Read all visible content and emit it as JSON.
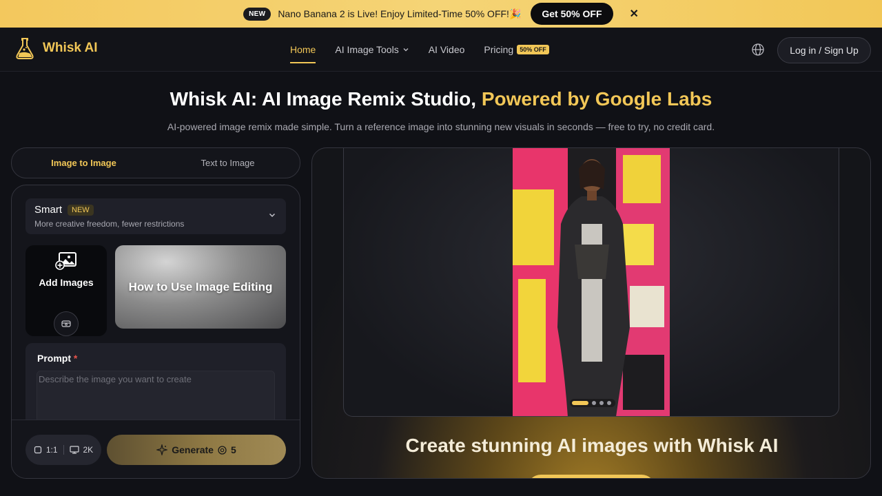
{
  "promo": {
    "badge": "NEW",
    "text": "Nano Banana 2 is Live! Enjoy Limited-Time 50% OFF!🎉",
    "cta": "Get 50% OFF",
    "close": "✕"
  },
  "nav": {
    "brand": "Whisk AI",
    "items": [
      {
        "label": "Home",
        "active": true
      },
      {
        "label": "AI Image Tools",
        "dropdown": true
      },
      {
        "label": "AI Video"
      },
      {
        "label": "Pricing",
        "badge": "50% OFF"
      }
    ],
    "language_icon": "globe-icon",
    "login": "Log in / Sign Up"
  },
  "hero": {
    "title": "Whisk AI: AI Image Remix Studio, ",
    "title_highlight": "Powered by Google Labs",
    "subtitle": "AI-powered image remix made simple. Turn a reference image into stunning new visuals in seconds — free to try, no credit card."
  },
  "generator": {
    "tabs": [
      {
        "label": "Image to Image",
        "active": true
      },
      {
        "label": "Text to Image",
        "active": false
      }
    ],
    "model": {
      "name": "Smart",
      "badge": "NEW",
      "description": "More creative freedom, fewer restrictions"
    },
    "add_images": "Add Images",
    "tutorial_card": "How to Use Image Editing",
    "prompt": {
      "label": "Prompt",
      "required_mark": "*",
      "placeholder": "Describe the image you want to create",
      "value": ""
    },
    "aspect_ratio": "1:1",
    "resolution": "2K",
    "generate": {
      "label": "Generate",
      "credits": "5"
    }
  },
  "showcase": {
    "carousel_total": 4,
    "carousel_active": 1,
    "headline": "Create stunning AI images with Whisk AI"
  },
  "colors": {
    "accent": "#f2c757",
    "background": "#101116",
    "panel": "#14151b"
  }
}
